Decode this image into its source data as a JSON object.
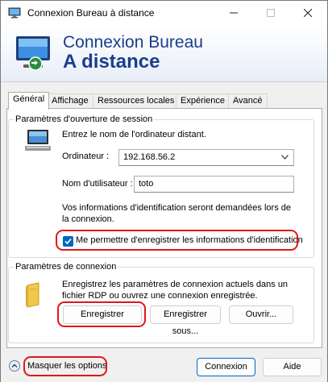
{
  "window": {
    "title": "Connexion Bureau à distance",
    "icon": "remote-desktop-icon"
  },
  "banner": {
    "line1": "Connexion Bureau",
    "line2": "A distance",
    "icon": "monitor-connection-icon"
  },
  "tabs": [
    {
      "label": "Général",
      "active": true
    },
    {
      "label": "Affichage",
      "active": false
    },
    {
      "label": "Ressources locales",
      "active": false
    },
    {
      "label": "Expérience",
      "active": false
    },
    {
      "label": "Avancé",
      "active": false
    }
  ],
  "session": {
    "legend": "Paramètres d'ouverture de session",
    "instruction": "Entrez le nom de l'ordinateur distant.",
    "computer_label": "Ordinateur :",
    "computer_value": "192.168.56.2",
    "username_label": "Nom d'utilisateur :",
    "username_value": "toto",
    "info": "Vos informations d'identification seront demandées lors de la connexion.",
    "remember_label": "Me permettre d'enregistrer les informations d'identification",
    "remember_checked": true
  },
  "connection": {
    "legend": "Paramètres de connexion",
    "description": "Enregistrez les paramètres de connexion actuels dans un fichier RDP ou ouvrez une connexion enregistrée.",
    "save_label": "Enregistrer",
    "save_as_label": "Enregistrer sous...",
    "open_label": "Ouvrir..."
  },
  "footer": {
    "hide_options_label": "Masquer les options",
    "connect_label": "Connexion",
    "help_label": "Aide"
  },
  "colors": {
    "accent": "#0067c0",
    "highlight": "#e0161b",
    "banner_text": "#1a3e8c"
  }
}
